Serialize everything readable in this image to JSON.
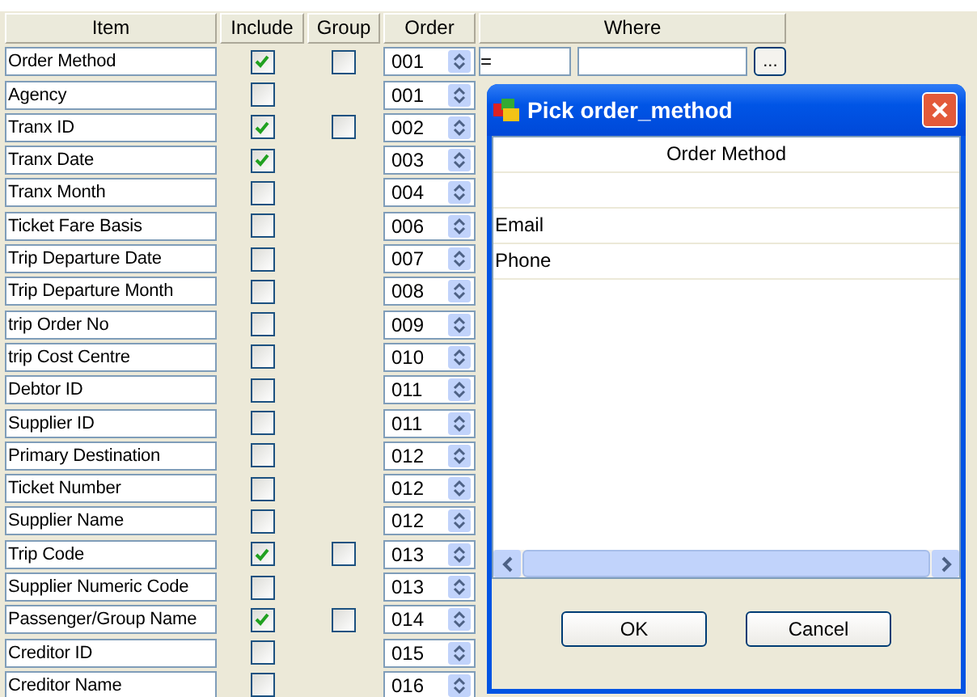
{
  "columns": [
    "Item",
    "Include",
    "Group",
    "Order",
    "Where"
  ],
  "rows": [
    {
      "item": "Order Method",
      "include": true,
      "group": {
        "checked": false
      },
      "order": "001",
      "where": {
        "operator": "=",
        "button": "..."
      }
    },
    {
      "item": "Agency",
      "include": false,
      "order": "001"
    },
    {
      "item": "Tranx ID",
      "include": true,
      "group": {
        "checked": false
      },
      "order": "002"
    },
    {
      "item": "Tranx Date",
      "include": true,
      "order": "003"
    },
    {
      "item": "Tranx Month",
      "include": false,
      "order": "004"
    },
    {
      "item": "Ticket Fare Basis",
      "include": false,
      "order": "006"
    },
    {
      "item": "Trip Departure Date",
      "include": false,
      "order": "007"
    },
    {
      "item": "Trip Departure Month",
      "include": false,
      "order": "008"
    },
    {
      "item": "trip Order No",
      "include": false,
      "order": "009"
    },
    {
      "item": "trip Cost Centre",
      "include": false,
      "order": "010"
    },
    {
      "item": "Debtor ID",
      "include": false,
      "order": "011"
    },
    {
      "item": "Supplier ID",
      "include": false,
      "order": "011"
    },
    {
      "item": "Primary Destination",
      "include": false,
      "order": "012"
    },
    {
      "item": "Ticket Number",
      "include": false,
      "order": "012"
    },
    {
      "item": "Supplier Name",
      "include": false,
      "order": "012"
    },
    {
      "item": "Trip Code",
      "include": true,
      "group": {
        "checked": false
      },
      "order": "013"
    },
    {
      "item": "Supplier Numeric Code",
      "include": false,
      "order": "013"
    },
    {
      "item": "Passenger/Group Name",
      "include": true,
      "group": {
        "checked": false
      },
      "order": "014"
    },
    {
      "item": "Creditor ID",
      "include": false,
      "order": "015"
    },
    {
      "item": "Creditor Name",
      "include": false,
      "order": "016"
    }
  ],
  "dialog": {
    "title": "Pick order_method",
    "list_header": "Order Method",
    "options": [
      {
        "kind": "blank"
      },
      {
        "kind": "text",
        "label": "Email"
      },
      {
        "kind": "text",
        "label": "Phone"
      }
    ],
    "buttons": [
      "OK",
      "Cancel"
    ]
  }
}
